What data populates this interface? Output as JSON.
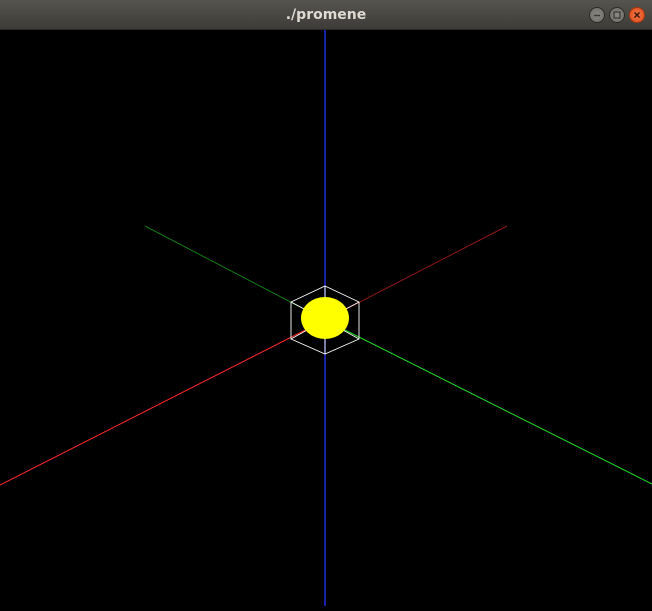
{
  "window": {
    "title": "./promene",
    "controls": [
      "minimize-icon",
      "maximize-icon",
      "close-icon"
    ]
  },
  "scene": {
    "background": "#000000",
    "axis_colors": {
      "x": "#ff2a2a",
      "y": "#22dd22",
      "z": "#2233ff"
    },
    "cube_color": "#ffffff",
    "sphere_color": "#ffff00"
  }
}
